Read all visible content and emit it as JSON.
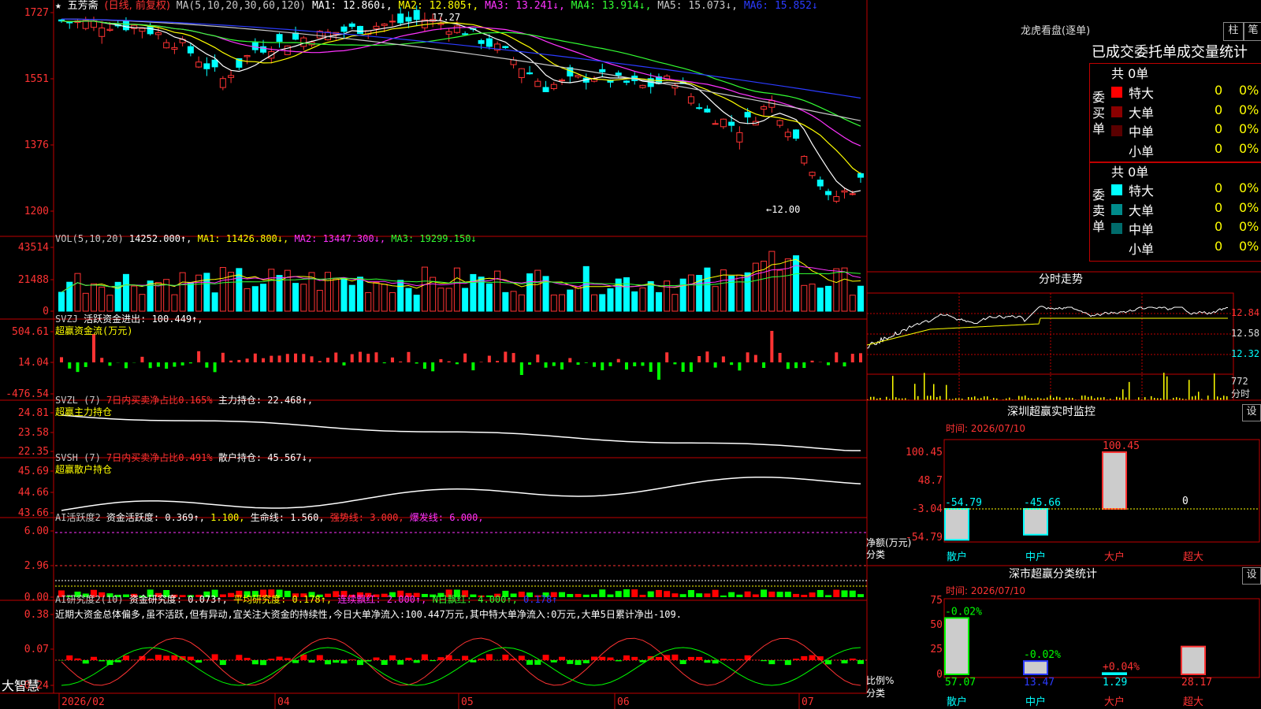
{
  "stock": {
    "star": "★",
    "name": "五芳斋",
    "mode": "(日线, 前复权)"
  },
  "main_header": [
    {
      "t": "MA(5,10,20,30,60,120) ",
      "c": "#c8c8c8"
    },
    {
      "t": "MA1: 12.860↓,",
      "c": "#ffffff"
    },
    {
      "t": " MA2: 12.805↑,",
      "c": "#ffff00"
    },
    {
      "t": " MA3: 13.241↓,",
      "c": "#ff33ff"
    },
    {
      "t": " MA4: 13.914↓,",
      "c": "#33ff33"
    },
    {
      "t": " MA5: 15.073↓,",
      "c": "#c8c8c8"
    },
    {
      "t": " MA6: 15.852↓",
      "c": "#2b3bff"
    }
  ],
  "price_axis": [
    "1727",
    "1551",
    "1376",
    "1200"
  ],
  "price_annotations": {
    "high": "17.27",
    "low": "←12.00"
  },
  "vol_header": [
    {
      "t": "VOL(5,10,20) ",
      "c": "#c8c8c8"
    },
    {
      "t": "14252.000↑,",
      "c": "#ffffff"
    },
    {
      "t": " MA1: 11426.800↓,",
      "c": "#ffff00"
    },
    {
      "t": " MA2: 13447.300↓,",
      "c": "#ff33ff"
    },
    {
      "t": " MA3: 19299.150↓",
      "c": "#33ff33"
    }
  ],
  "vol_axis": [
    "43514",
    "21488",
    "0"
  ],
  "svzj_header": [
    {
      "t": "SVZJ  ",
      "c": "#c8c8c8"
    },
    {
      "t": "活跃资金进出: 100.449↑,",
      "c": "#ffffff"
    }
  ],
  "svzj_sub": "超赢资金流(万元)",
  "svzj_axis": [
    "504.61",
    "14.04",
    "-476.54"
  ],
  "svzl_header": [
    {
      "t": "SVZL (7) ",
      "c": "#c8c8c8"
    },
    {
      "t": "7日内买卖净占比0.165%",
      "c": "#ff3333"
    },
    {
      "t": " 主力持仓: 22.468↑,",
      "c": "#ffffff"
    }
  ],
  "svzl_sub": "超赢主力持仓",
  "svzl_axis": [
    "24.81",
    "23.58",
    "22.35"
  ],
  "svsh_header": [
    {
      "t": "SVSH (7) ",
      "c": "#c8c8c8"
    },
    {
      "t": "7日内买卖净占比0.491%",
      "c": "#ff3333"
    },
    {
      "t": " 散户持仓: 45.567↓,",
      "c": "#ffffff"
    }
  ],
  "svsh_sub": "超赢散户持仓",
  "svsh_axis": [
    "45.69",
    "44.66",
    "43.66"
  ],
  "ai1_header": [
    {
      "t": "AI活跃度2 ",
      "c": "#c8c8c8"
    },
    {
      "t": "资金活跃度: 0.369↑,",
      "c": "#ffffff"
    },
    {
      "t": " 1.100,",
      "c": "#ffff00"
    },
    {
      "t": " 生命线: 1.560,",
      "c": "#ffffff"
    },
    {
      "t": " 强势线: 3.000,",
      "c": "#ff3333"
    },
    {
      "t": " 爆发线: 6.000,",
      "c": "#ff33ff"
    }
  ],
  "ai1_axis": [
    "6.00",
    "2.96",
    "0.00"
  ],
  "ai2_header": [
    {
      "t": "AI研究度2(10) ",
      "c": "#c8c8c8"
    },
    {
      "t": "资金研究度: 0.073↑,",
      "c": "#ffffff"
    },
    {
      "t": " 平均研究度: 0.178↑,",
      "c": "#ffff00"
    },
    {
      "t": " 连续飘红: 2.000↑,",
      "c": "#ff33ff"
    },
    {
      "t": " N日飘红: 4.000↑,",
      "c": "#33ff33"
    },
    {
      "t": " 0.178↑",
      "c": "#2b3bff"
    }
  ],
  "ai2_text": "近期大资金总体偏多,虽不活跃,但有异动,宜关注大资金的持续性,今日大单净流入:100.447万元,其中特大单净流入:0万元,大单5日累计净出-109.",
  "ai2_axis": [
    "0.38",
    "0.07",
    "-0.24"
  ],
  "dates": [
    "2026/02",
    "04",
    "05",
    "06",
    "07"
  ],
  "brand": "大智慧",
  "lhb": {
    "title": "龙虎看盘(逐单)",
    "btn1": "柱",
    "btn2": "笔",
    "subtitle": "已成交委托单成交量统计",
    "buy": {
      "side": "委买单",
      "total": "共 0单",
      "rows": [
        {
          "label": "特大",
          "v": "0",
          "p": "0%",
          "c": "#ff0000"
        },
        {
          "label": "大单",
          "v": "0",
          "p": "0%",
          "c": "#8b0000"
        },
        {
          "label": "中单",
          "v": "0",
          "p": "0%",
          "c": "#5a0000"
        },
        {
          "label": "小单",
          "v": "0",
          "p": "0%",
          "c": "#000000"
        }
      ]
    },
    "sell": {
      "side": "委卖单",
      "total": "共 0单",
      "rows": [
        {
          "label": "特大",
          "v": "0",
          "p": "0%",
          "c": "#00ffff"
        },
        {
          "label": "大单",
          "v": "0",
          "p": "0%",
          "c": "#008b8b"
        },
        {
          "label": "中单",
          "v": "0",
          "p": "0%",
          "c": "#006b6b"
        },
        {
          "label": "小单",
          "v": "0",
          "p": "0%",
          "c": "#000000"
        }
      ]
    }
  },
  "fenshi": {
    "title": "分时走势",
    "axis": [
      "12.84",
      "12.58",
      "12.32"
    ],
    "vol": "772",
    "unit": "分时"
  },
  "monitor": {
    "title": "深圳超赢实时监控",
    "btn": "设",
    "time": "时间: 2026/07/10",
    "axis": [
      "100.45",
      "48.7",
      "-3.04",
      "-54.79"
    ],
    "ylabel": "净额(万元)",
    "xlabel": "分类"
  },
  "classify": {
    "title": "深市超赢分类统计",
    "btn": "设",
    "time": "时间: 2026/07/10",
    "axis": [
      "75",
      "50",
      "25",
      "0"
    ],
    "ylabel": "比例%",
    "xlabel": "分类"
  },
  "chart_data": [
    {
      "type": "candlestick",
      "title": "五芳斋(日线, 前复权)",
      "dates": [
        "2026/02",
        "04",
        "05",
        "06",
        "07"
      ],
      "ma": {
        "MA1": 12.86,
        "MA2": 12.805,
        "MA3": 13.241,
        "MA4": 13.914,
        "MA5": 15.073,
        "MA6": 15.852
      },
      "high": 17.27,
      "low": 12.0,
      "ylim": [
        12.0,
        17.27
      ]
    },
    {
      "type": "bar",
      "title": "深圳超赢实时监控",
      "categories": [
        "散户",
        "中户",
        "大户",
        "超大"
      ],
      "values": [
        -54.79,
        -45.66,
        100.45,
        0
      ],
      "ylabel": "净额(万元)"
    },
    {
      "type": "bar",
      "title": "深市超赢分类统计",
      "categories": [
        "散户",
        "中户",
        "大户",
        "超大"
      ],
      "values": [
        57.07,
        13.47,
        1.29,
        28.17
      ],
      "changes": [
        "-0.02%",
        "-0.02%",
        "+0.04%",
        ""
      ],
      "ylabel": "比例%",
      "ylim": [
        0,
        75
      ]
    }
  ]
}
